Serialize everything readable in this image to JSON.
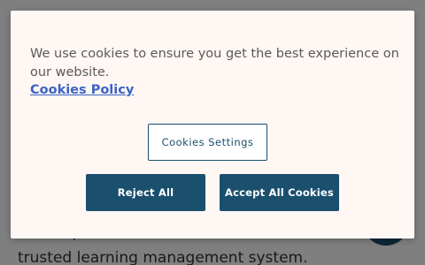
{
  "background": {
    "text": "Moodle, the world's most customisable and trusted learning management system."
  },
  "cookie_banner": {
    "message": "We use cookies to ensure you get the best experience on our website.",
    "policy_link": "Cookies Policy",
    "settings_label": "Cookies Settings",
    "reject_label": "Reject All",
    "accept_label": "Accept All Cookies"
  },
  "colors": {
    "brand": "#1b4f6e",
    "link": "#3b64c4",
    "dialog_bg": "#fff7f4"
  }
}
